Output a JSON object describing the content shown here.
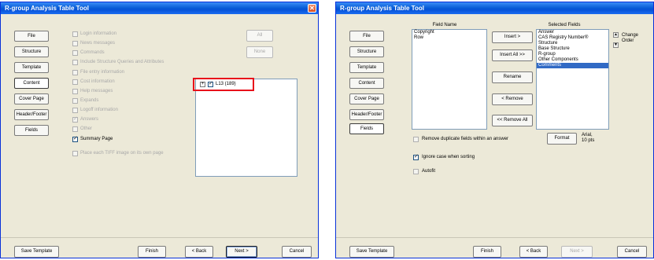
{
  "left": {
    "title": "R-group Analysis Table Tool",
    "nav": [
      "File",
      "Structure",
      "Template",
      "Content",
      "Cover Page",
      "Header/Footer",
      "Fields"
    ],
    "active_nav": "Content",
    "options": [
      {
        "label": "Login information",
        "checked": false,
        "enabled": false
      },
      {
        "label": "News messages",
        "checked": false,
        "enabled": false
      },
      {
        "label": "Commands",
        "checked": false,
        "enabled": false
      },
      {
        "label": "Include Structure Queries and Attributes",
        "checked": false,
        "enabled": false
      },
      {
        "label": "File entry information",
        "checked": false,
        "enabled": false
      },
      {
        "label": "Cost information",
        "checked": false,
        "enabled": false
      },
      {
        "label": "Help messages",
        "checked": false,
        "enabled": false
      },
      {
        "label": "Expands",
        "checked": false,
        "enabled": false
      },
      {
        "label": "Logoff information",
        "checked": false,
        "enabled": false
      },
      {
        "label": "Answers",
        "checked": true,
        "enabled": false
      },
      {
        "label": "Other",
        "checked": false,
        "enabled": false
      },
      {
        "label": "Summary Page",
        "checked": true,
        "enabled": true
      },
      {
        "label": "Place each TIFF image on its own page",
        "checked": false,
        "enabled": false
      }
    ],
    "all_label": "All",
    "none_label": "None",
    "tree": {
      "expand": "+",
      "label": "L13 (189)",
      "checked": true
    },
    "highlight_color": "#e8121b",
    "bottom": {
      "save": "Save Template",
      "finish": "Finish",
      "back": "< Back",
      "next": "Next >",
      "cancel": "Cancel"
    }
  },
  "right": {
    "title": "R-group Analysis Table Tool",
    "nav": [
      "File",
      "Structure",
      "Template",
      "Content",
      "Cover Page",
      "Header/Footer",
      "Fields"
    ],
    "active_nav": "Fields",
    "field_name_header": "Field Name",
    "selected_fields_header": "Selected Fields",
    "field_names": [
      "Copyright",
      "Row"
    ],
    "selected_fields": [
      "Answer",
      "CAS Registry Number®",
      "Structure",
      "Base Structure",
      "R-group",
      "Other Components",
      "Comments"
    ],
    "selected_index": 6,
    "mid_buttons": [
      "Insert >",
      "Insert All >>",
      "Rename",
      "< Remove",
      "<< Remove All"
    ],
    "change_order": "Change\nOrder",
    "change_order_lines": [
      "Change",
      "Order"
    ],
    "format_label": "Format",
    "format_value_lines": [
      "Arial,",
      "10 pts"
    ],
    "remove_dup": {
      "label": "Remove duplicate fields within an answer",
      "checked": false
    },
    "ignore_case": {
      "label": "Ignore case when sorting",
      "checked": true
    },
    "autofit": {
      "label": "Autofit",
      "checked": false
    },
    "bottom": {
      "save": "Save Template",
      "finish": "Finish",
      "back": "< Back",
      "next": "Next >",
      "cancel": "Cancel"
    }
  }
}
